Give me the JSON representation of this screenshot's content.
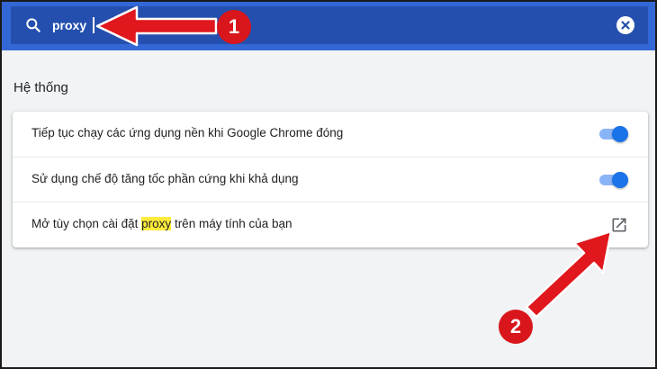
{
  "search": {
    "query": "proxy",
    "search_icon": "search-icon",
    "clear_icon": "close-circle-icon"
  },
  "section": {
    "title": "Hệ thống"
  },
  "settings": {
    "rows": [
      {
        "label": "Tiếp tục chạy các ứng dụng nền khi Google Chrome đóng",
        "control": "toggle",
        "enabled": true
      },
      {
        "label": "Sử dụng chế độ tăng tốc phần cứng khi khả dụng",
        "control": "toggle",
        "enabled": true
      },
      {
        "label_before": "Mở tùy chọn cài đặt ",
        "label_highlight": "proxy",
        "label_after": " trên máy tính của bạn",
        "control": "external-link",
        "icon": "open-in-new-icon"
      }
    ]
  },
  "annotations": {
    "step1": "1",
    "step2": "2",
    "arrow_color": "#e0171c"
  },
  "colors": {
    "header_bg": "#3367d6",
    "search_bg": "#254fae",
    "toggle_on": "#1a73e8",
    "highlight": "#ffeb3b"
  }
}
